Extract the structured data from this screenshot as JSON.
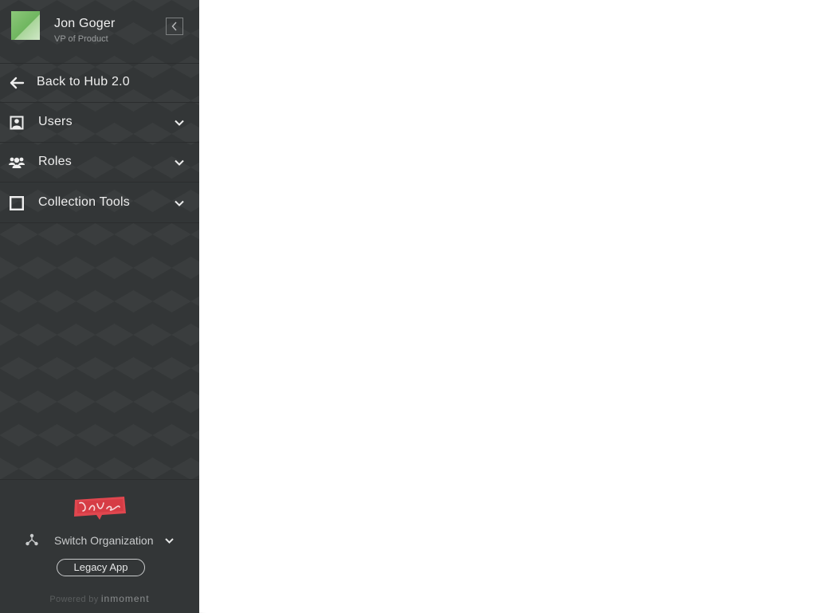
{
  "user": {
    "name": "Jon Goger",
    "title": "VP of Product"
  },
  "nav": {
    "back": {
      "label": "Back to Hub 2.0",
      "icon": "arrow-left-icon"
    },
    "items": [
      {
        "label": "Users",
        "icon": "user-card-icon"
      },
      {
        "label": "Roles",
        "icon": "people-group-icon"
      },
      {
        "label": "Collection Tools",
        "icon": "square-outline-icon"
      }
    ]
  },
  "footer": {
    "brand_logo": "Life Unboxed",
    "switch_org_label": "Switch Organization",
    "legacy_app_label": "Legacy App",
    "powered_by_prefix": "Powered by",
    "powered_by_brand": "inmoment"
  },
  "colors": {
    "sidebar_bg": "#333637",
    "brand_red": "#e0474f",
    "avatar_green": "#7dbf6a"
  }
}
